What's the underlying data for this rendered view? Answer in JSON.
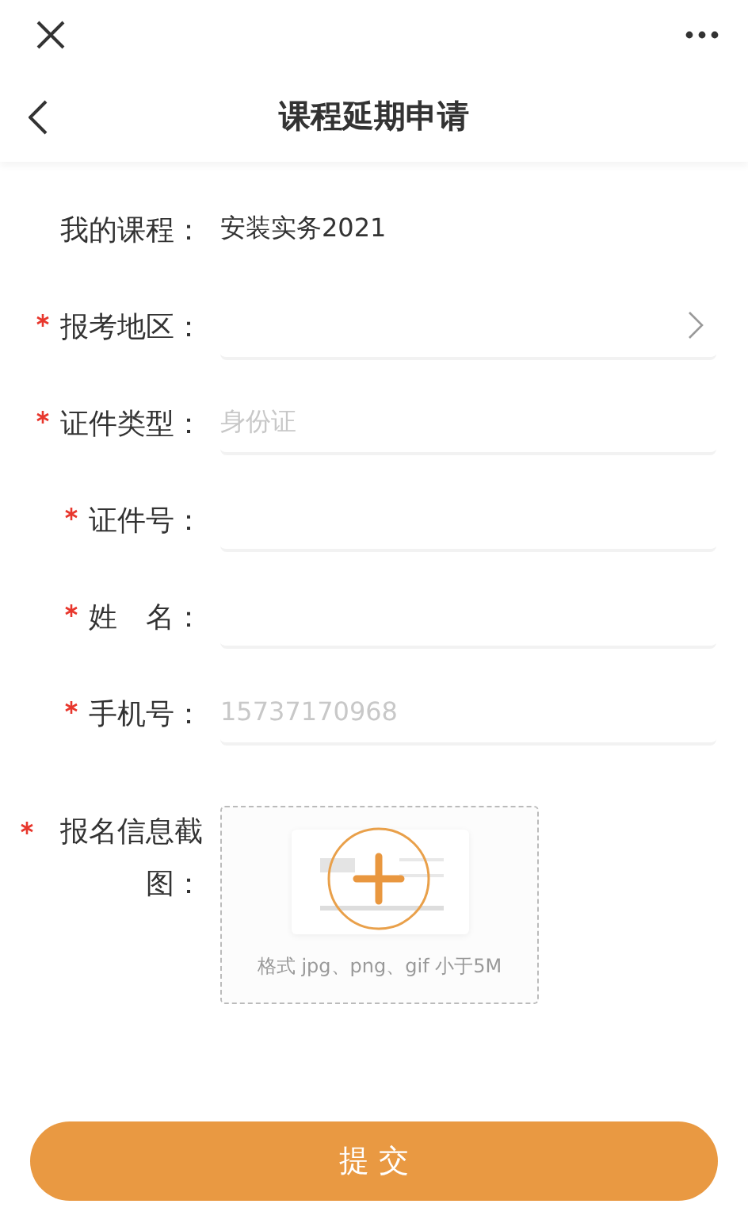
{
  "navigation": {
    "title": "课程延期申请"
  },
  "form": {
    "fields": [
      {
        "kind": "static",
        "label": "我的课程：",
        "required": false,
        "value": "安装实务2021"
      },
      {
        "kind": "select",
        "label": "报考地区：",
        "required": true
      },
      {
        "kind": "input",
        "label": "证件类型：",
        "required": true,
        "placeholder": "身份证"
      },
      {
        "kind": "input",
        "label": "证件号：",
        "required": true
      },
      {
        "kind": "input",
        "label": "姓　名：",
        "required": true
      },
      {
        "kind": "input",
        "label": "手机号：",
        "required": true,
        "placeholder": "15737170968"
      }
    ],
    "upload": {
      "label": "报名信息截图：",
      "required": true,
      "hint": "格式 jpg、png、gif 小于5M"
    }
  },
  "submit_button": "提 交"
}
